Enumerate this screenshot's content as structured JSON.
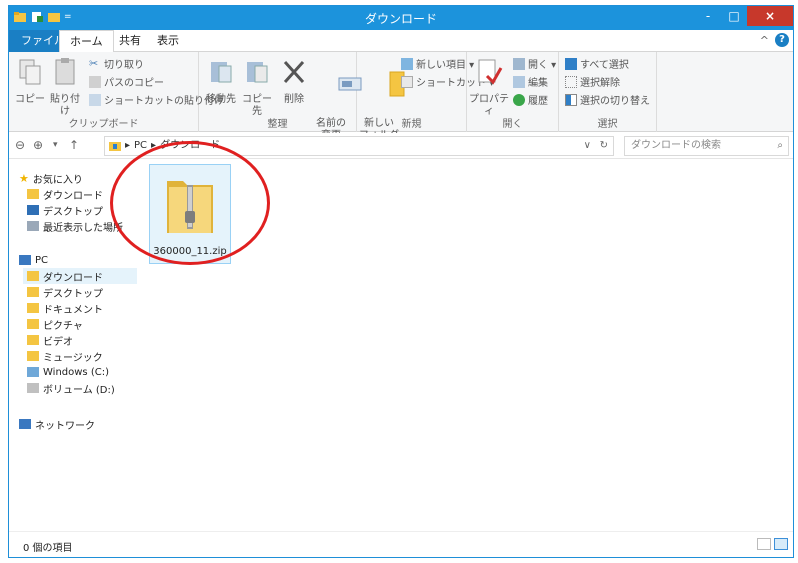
{
  "window": {
    "title": "ダウンロード",
    "controls": {
      "minimize": "-",
      "maximize": "□",
      "close": "×"
    }
  },
  "ribbon_tabs": {
    "file": "ファイル",
    "home": "ホーム",
    "share": "共有",
    "view": "表示"
  },
  "ribbon": {
    "clipboard": {
      "label": "クリップボード",
      "copy": "コピー",
      "paste": "貼り付け",
      "cut": "切り取り",
      "copy_path": "パスのコピー",
      "paste_shortcut": "ショートカットの貼り付け"
    },
    "organize": {
      "label": "整理",
      "move_to": "移動先",
      "copy_to": "コピー先",
      "delete": "削除",
      "rename": "名前の\n変更"
    },
    "new": {
      "label": "新規",
      "new_folder": "新しい\nフォルダー",
      "new_item": "新しい項目 ▾",
      "shortcut": "ショートカット ▾"
    },
    "open": {
      "label": "開く",
      "properties": "プロパティ",
      "open": "開く ▾",
      "edit": "編集",
      "history": "履歴"
    },
    "select": {
      "label": "選択",
      "select_all": "すべて選択",
      "select_none": "選択解除",
      "invert": "選択の切り替え"
    }
  },
  "address": {
    "crumbs": [
      "PC",
      "ダウンロード"
    ],
    "search_placeholder": "ダウンロードの検索"
  },
  "navpane": {
    "favorites": "お気に入り",
    "fav_items": [
      "ダウンロード",
      "デスクトップ",
      "最近表示した場所"
    ],
    "pc": "PC",
    "pc_items": [
      "ダウンロード",
      "デスクトップ",
      "ドキュメント",
      "ピクチャ",
      "ビデオ",
      "ミュージック",
      "Windows (C:)",
      "ボリューム (D:)"
    ],
    "network": "ネットワーク"
  },
  "files": [
    {
      "name": "360000_11.zip"
    }
  ],
  "status": {
    "count_text": "0 個の項目"
  },
  "colors": {
    "accent": "#1c93dc",
    "highlight_ring": "#e02020",
    "selection": "#e5f3fb"
  }
}
